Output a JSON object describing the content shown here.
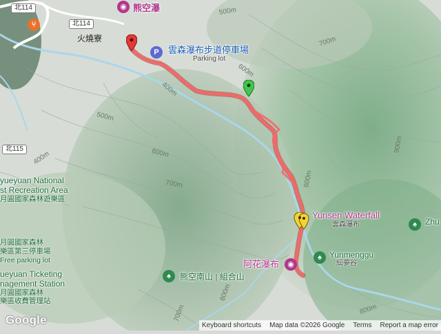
{
  "map": {
    "roads": {
      "shield_114_top": "北114",
      "shield_114": "北114",
      "shield_115": "北115"
    },
    "places": {
      "huoshaoliao": "火燒寮"
    },
    "pois": {
      "xiongkong_falls": "熊空瀑",
      "parking": "雲森瀑布步道停車場",
      "parking_sub": "Parking lot",
      "yunsen_waterfall": "Yunsen Waterfall",
      "yunsen_waterfall_zh": "雲森瀑布",
      "ahua_falls": "阿花瀑布",
      "yunmenggu": "Yunmenggu",
      "yunmenggu_zh": "紜夢谷",
      "xiongkong_nanshan": "熊空南山 | 組合山",
      "zhu": "Zhu"
    },
    "area_labels": {
      "line1": "yueyuan National",
      "line2": "st Recreation Area",
      "line3": "月圓國家森林遊樂區",
      "parking3_line1": "月圓國家森林",
      "parking3_line2": "樂區第三停車場",
      "parking3_line3": "Free parking lot",
      "ticketing_line1": "ueyuan Ticketing",
      "ticketing_line2": "nagement Station",
      "ticketing_line3": "月圓國家森林",
      "ticketing_line4": "樂區收費管理站"
    },
    "contours": {
      "c500_top": "500m",
      "c700_tr": "700m",
      "c600_upper": "600m",
      "c400_left": "400m",
      "c500_mid": "500m",
      "c600_mid": "600m",
      "c400_far_left": "400m",
      "c700_mid": "700m",
      "c900_right": "900m",
      "c600_route": "600m",
      "c800_low": "800m",
      "c800_br": "800m",
      "c700_bottom": "700m"
    },
    "icons": {
      "start_marker": "red-pin-icon",
      "end_marker": "green-pin-icon",
      "waypoint_marker": "yellow-pin-icon",
      "parking_icon": "parking-icon",
      "restaurant_icon": "restaurant-icon",
      "camera_icon": "camera-icon",
      "park_icon": "park-icon"
    },
    "colors": {
      "route": "#f06a6a",
      "route_outline": "#b23a3a",
      "river": "#a9d7ea",
      "parking_blue": "#5e6ad2",
      "poi_pink": "#b0368c",
      "poi_green": "#2f8a4f"
    }
  },
  "footer": {
    "logo": "Google",
    "keyboard": "Keyboard shortcuts",
    "map_data": "Map data ©2026 Google",
    "terms": "Terms",
    "report": "Report a map error"
  }
}
